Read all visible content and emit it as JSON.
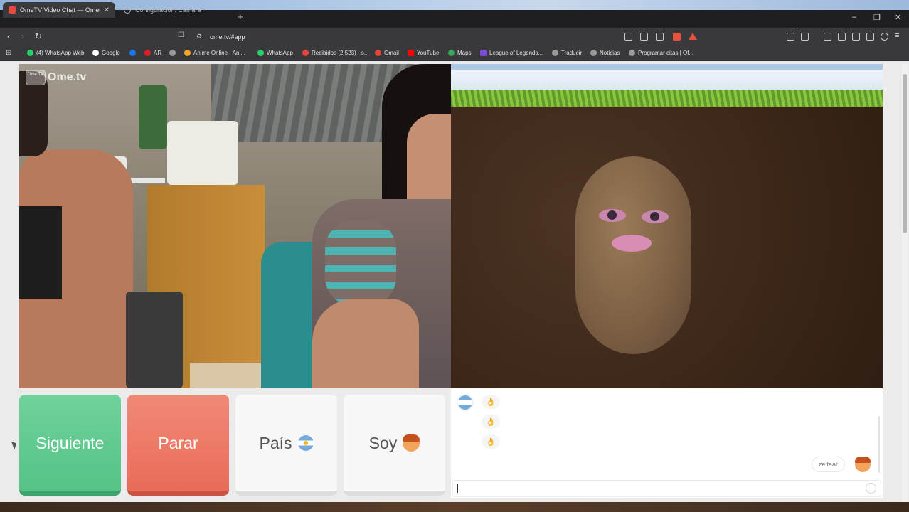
{
  "browser": {
    "tabs": [
      {
        "title": "OmeTV Video Chat — Omeg",
        "active": true
      },
      {
        "title": "Configuración: Cámara",
        "active": false
      }
    ],
    "new_tab": "+",
    "url": "ome.tv/#app",
    "window_controls": {
      "minimize": "–",
      "restore": "❐",
      "close": "✕"
    },
    "bookmarks": [
      {
        "label": "(4) WhatsApp Web",
        "color": "#25d366"
      },
      {
        "label": "Google",
        "color": "#ffffff"
      },
      {
        "label": "",
        "color": "#1877f2"
      },
      {
        "label": "AR",
        "color": "#e02020"
      },
      {
        "label": "",
        "color": "#9a9a9a"
      },
      {
        "label": "Anime Online - Ani...",
        "color": "#f5a623"
      },
      {
        "label": "WhatsApp",
        "color": "#25d366"
      },
      {
        "label": "Recibidos (2.523) - s...",
        "color": "#ea4335"
      },
      {
        "label": "Gmail",
        "color": "#ea4335"
      },
      {
        "label": "YouTube",
        "color": "#ff0000"
      },
      {
        "label": "Maps",
        "color": "#34a853"
      },
      {
        "label": "League of Legends...",
        "color": "#7a4cd9"
      },
      {
        "label": "Traducir",
        "color": "#9a9a9a"
      },
      {
        "label": "Noticias",
        "color": "#9a9a9a"
      },
      {
        "label": "Programar citas | Of...",
        "color": "#9a9a9a"
      }
    ]
  },
  "app": {
    "logo_text": "Ome.tv",
    "logo_badge": "Ome TV",
    "buttons": {
      "next": "Siguiente",
      "stop": "Parar",
      "country": "País",
      "gender": "Soy"
    },
    "chat": {
      "messages": [
        "👌",
        "👌",
        "👌"
      ],
      "partner_name": "zeltear",
      "input_placeholder": ""
    }
  }
}
